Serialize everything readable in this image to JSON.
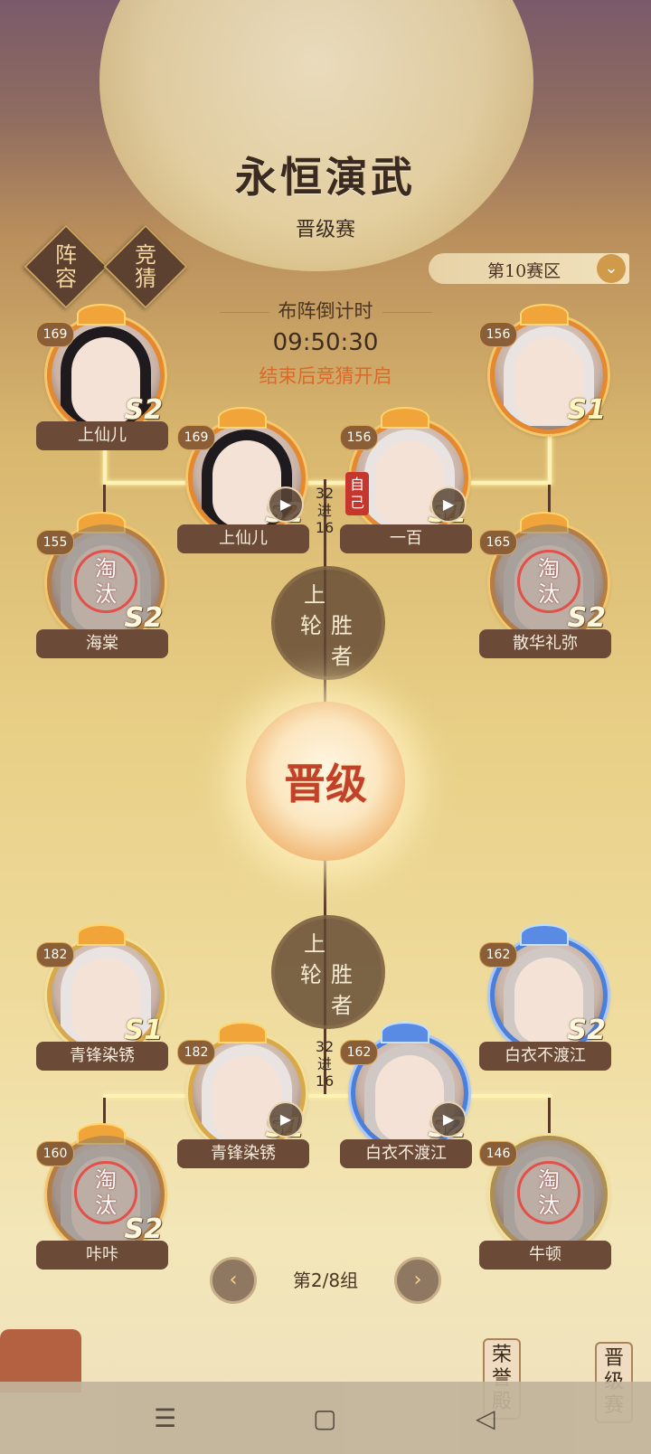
{
  "header": {
    "title": "永恒演武",
    "subtitle": "晋级赛",
    "side_buttons": [
      "阵容",
      "竞猜"
    ],
    "zone_label": "第10赛区",
    "countdown_label": "布阵倒计时",
    "countdown_time": "09:50:30",
    "notice": "结束后竞猜开启"
  },
  "top_bracket": {
    "round_label": "32\n进\n16",
    "winner_label": [
      "上",
      "轮",
      "胜",
      "者"
    ],
    "players": [
      {
        "level": "169",
        "name": "上仙儿",
        "tier": "S2"
      },
      {
        "level": "156",
        "name": "",
        "tier": "S1"
      },
      {
        "level": "169",
        "name": "上仙儿",
        "tier": "S2"
      },
      {
        "level": "156",
        "name": "一百",
        "tier": "S1",
        "tag": "自己"
      },
      {
        "level": "155",
        "name": "海棠",
        "tier": "S2",
        "status": "淘汰"
      },
      {
        "level": "165",
        "name": "散华礼弥",
        "tier": "S2",
        "status": "淘汰"
      }
    ]
  },
  "center_badge": "晋级",
  "bottom_bracket": {
    "round_label": "32\n进\n16",
    "winner_label": [
      "上",
      "轮",
      "胜",
      "者"
    ],
    "players": [
      {
        "level": "182",
        "name": "青锋染锈",
        "tier": "S1"
      },
      {
        "level": "162",
        "name": "白衣不渡江",
        "tier": "S2"
      },
      {
        "level": "182",
        "name": "青锋染锈",
        "tier": "S1"
      },
      {
        "level": "162",
        "name": "白衣不渡江",
        "tier": "S2"
      },
      {
        "level": "160",
        "name": "咔咔",
        "tier": "S2",
        "status": "淘汰"
      },
      {
        "level": "146",
        "name": "牛顿",
        "tier": "",
        "status": "淘汰"
      }
    ]
  },
  "pager": {
    "text": "第2/8组",
    "prev": "‹",
    "next": "›"
  },
  "bottom_nav": {
    "hall": "荣誉殿",
    "promotion": "晋级赛",
    "system": [
      "☰",
      "▢",
      "◁"
    ]
  },
  "colors": {
    "accent": "#e4892f",
    "eliminated": "#e2504a",
    "glow_line": "#fff2b8",
    "notice": "#d96a2a"
  }
}
